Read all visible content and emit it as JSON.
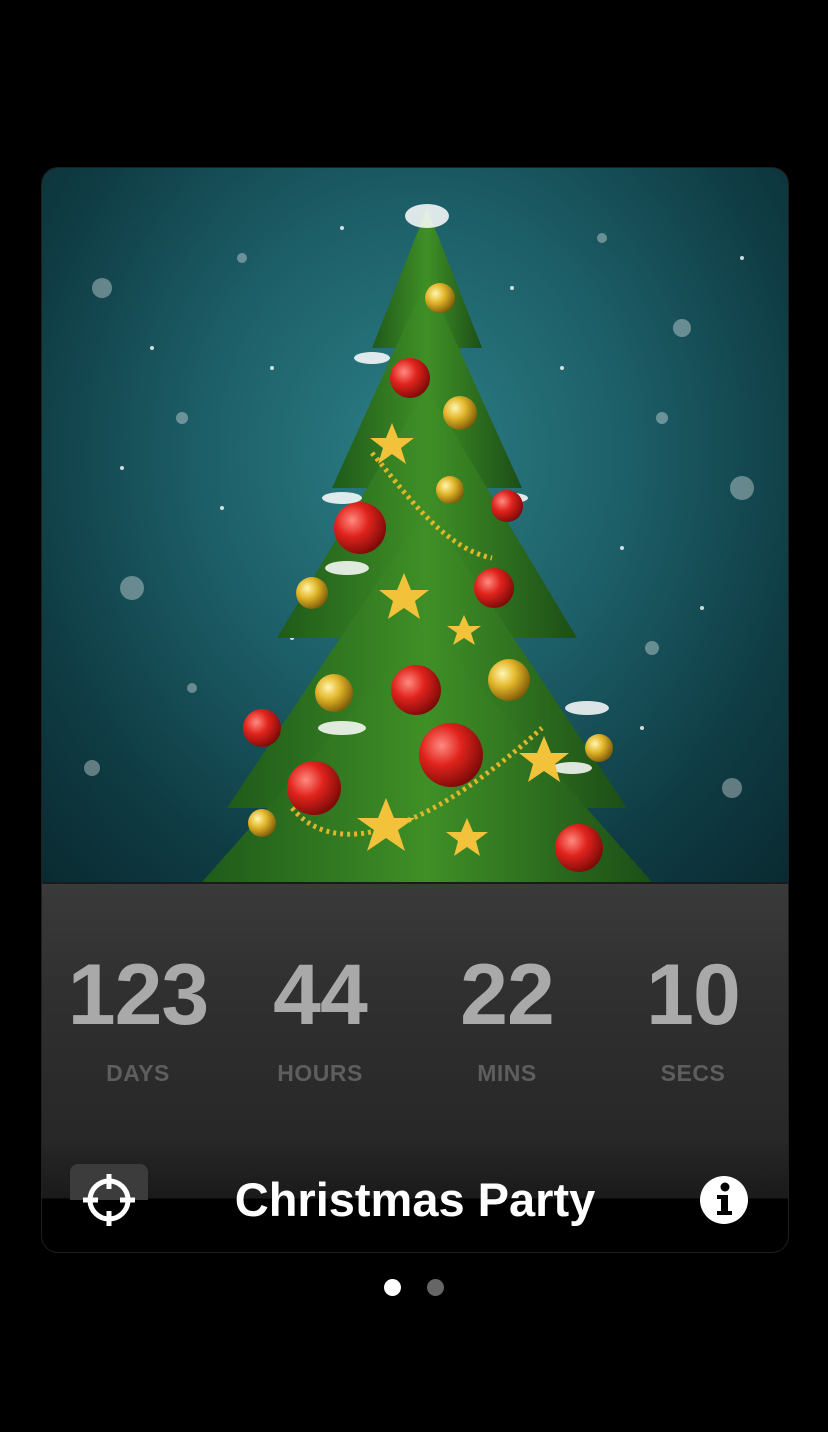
{
  "event": {
    "title": "Christmas Party"
  },
  "countdown": {
    "days": {
      "value": "123",
      "label": "DAYS"
    },
    "hours": {
      "value": "44",
      "label": "HOURS"
    },
    "mins": {
      "value": "22",
      "label": "MINS"
    },
    "secs": {
      "value": "10",
      "label": "SECS"
    }
  },
  "pager": {
    "total": 2,
    "active_index": 0
  },
  "icons": {
    "left": "crosshair-icon",
    "right": "info-icon"
  },
  "colors": {
    "background": "#000000",
    "countdown_numbers": "#a9a9a9",
    "countdown_labels": "#5e5e5e",
    "title": "#ffffff",
    "photo_sky": "#1d5f68"
  }
}
